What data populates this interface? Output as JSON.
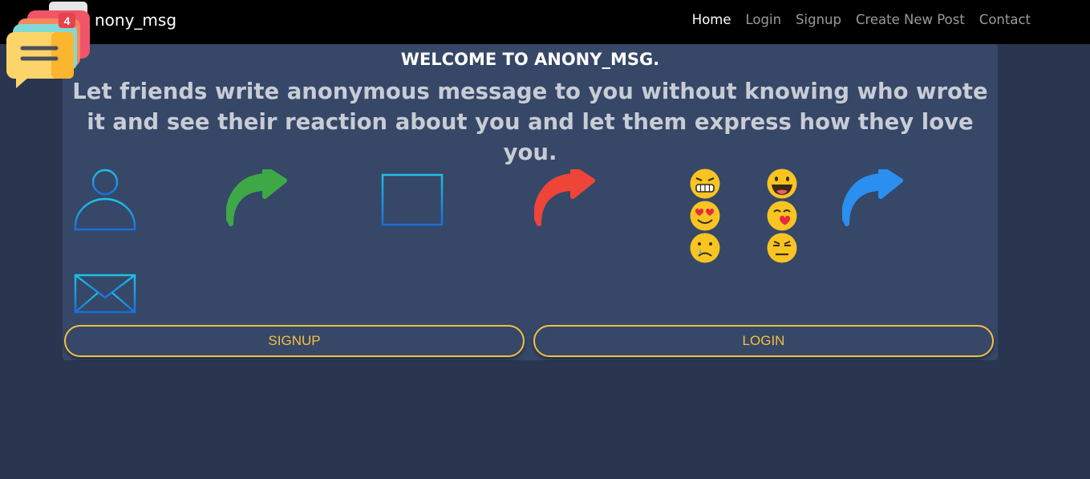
{
  "navbar": {
    "brand": "nony_msg",
    "badge_count": "4",
    "links": [
      "Home",
      "Login",
      "Signup",
      "Create New Post",
      "Contact"
    ],
    "active_link": "Home"
  },
  "hero": {
    "title": "WELCOME TO ANONY_MSG.",
    "tagline": "Let friends write anonymous message to you without knowing who wrote it and see their reaction about you and let them express how they love you."
  },
  "buttons": {
    "signup": "SIGNUP",
    "login": "LOGIN"
  },
  "icons": [
    "user-icon",
    "green-arrow-icon",
    "browser-window-icon",
    "red-arrow-icon",
    "emoji-grid-icon",
    "blue-arrow-icon",
    "envelope-icon"
  ],
  "colors": {
    "navbar_bg": "#000000",
    "page_bg": "#2a3650",
    "card_bg": "#364768",
    "accent": "#f3c044"
  }
}
